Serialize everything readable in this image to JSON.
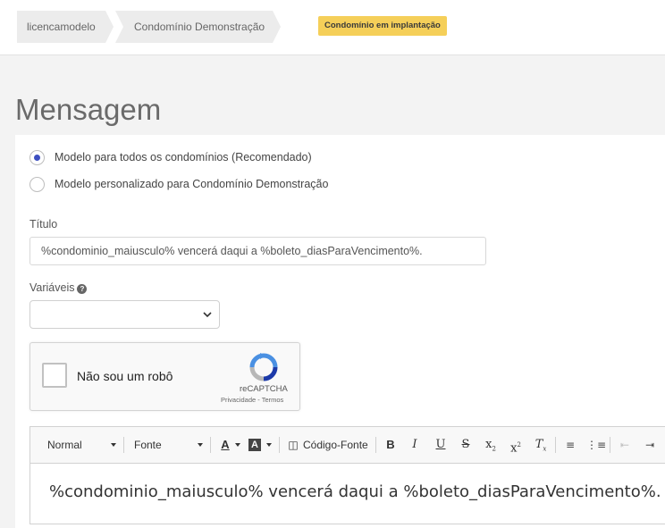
{
  "breadcrumb": {
    "items": [
      "licencamodelo",
      "Condomínio Demonstração"
    ],
    "status_badge": "Condomínio em implantação"
  },
  "page": {
    "title": "Mensagem"
  },
  "template_options": [
    {
      "label": "Modelo para todos os condomínios (Recomendado)",
      "checked": true
    },
    {
      "label": "Modelo personalizado para Condomínio Demonstração",
      "checked": false
    }
  ],
  "form": {
    "title_label": "Título",
    "title_value": "%condominio_maiusculo% vencerá daqui a %boleto_diasParaVencimento%.",
    "variables_label": "Variáveis",
    "variables_selected": ""
  },
  "captcha": {
    "label": "Não sou um robô",
    "brand": "reCAPTCHA",
    "links": "Privacidade - Termos"
  },
  "editor": {
    "format_select": "Normal",
    "font_select": "Fonte",
    "source_button": "Código-Fonte",
    "content": "%condominio_maiusculo% vencerá daqui a %boleto_diasParaVencimento%."
  },
  "colors": {
    "badge": "#f5cf59",
    "radio_accent": "#3d4fc0",
    "panel_bg": "#ffffff",
    "page_bg": "#f3f3f3"
  }
}
